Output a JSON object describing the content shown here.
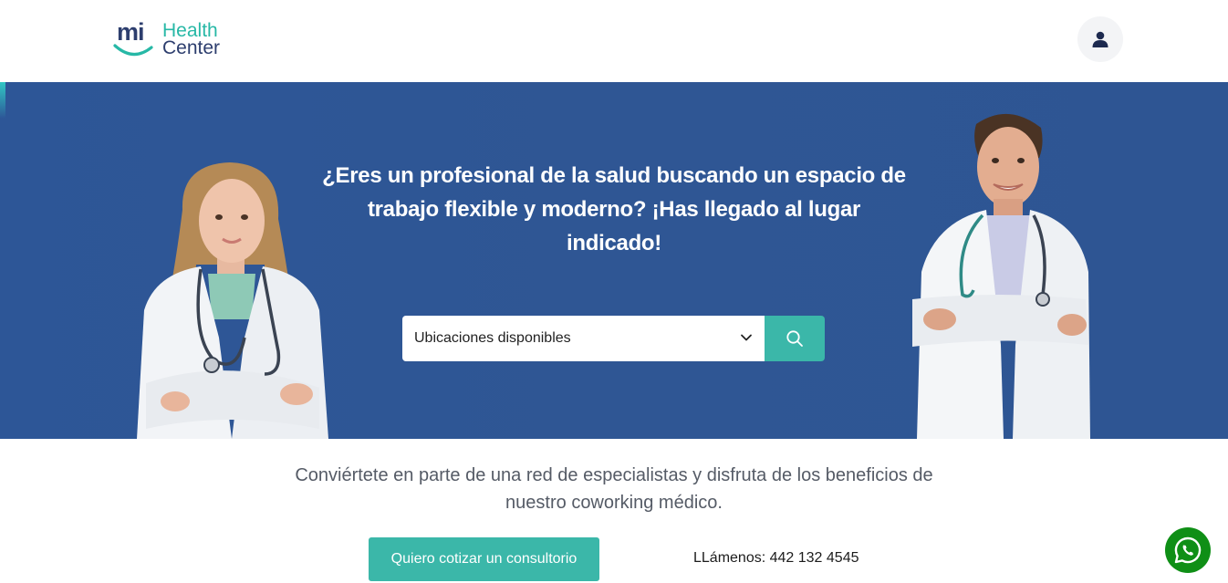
{
  "header": {
    "logo_mi": "mi",
    "logo_health": "Health",
    "logo_center": "Center"
  },
  "hero": {
    "title": "¿Eres un profesional de la salud buscando un espacio de trabajo flexible y moderno? ¡Has llegado al lugar indicado!",
    "select_value": "Ubicaciones disponibles"
  },
  "lower": {
    "lead": "Conviértete en parte de una red de especialistas y disfruta de los beneficios de nuestro coworking médico.",
    "cta_label": "Quiero cotizar un consultorio",
    "phone_text": "LLámenos: 442 132 4545"
  },
  "icons": {
    "user": "user-icon",
    "search": "search-icon",
    "chevron": "chevron-down-icon",
    "whatsapp": "whatsapp-icon"
  },
  "colors": {
    "brand_teal": "#3bb7a9",
    "brand_navy": "#2d3e6e",
    "hero_blue": "#2e5594",
    "whatsapp_green": "#0f8f16"
  }
}
